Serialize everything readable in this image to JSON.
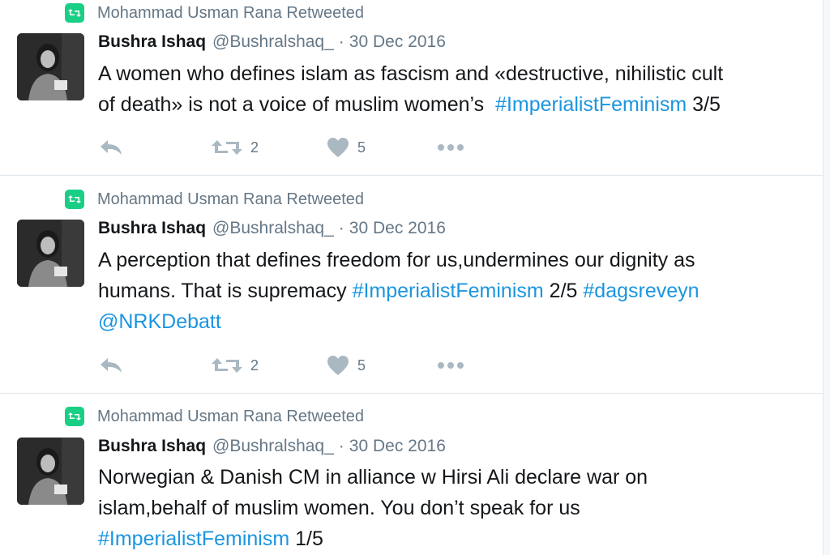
{
  "tweets": [
    {
      "retweeted_by": "Mohammad Usman Rana Retweeted",
      "name": "Bushra Ishaq",
      "handle": "@Bushralshaq_",
      "date": "30 Dec 2016",
      "lines": [
        [
          {
            "t": "A women who defines islam as fascism and «destructive, nihilistic cult"
          }
        ],
        [
          {
            "t": "of death» is not a voice of muslim women’s  "
          },
          {
            "t": "#ImperialistFeminism",
            "tag": true
          },
          {
            "t": " 3/5"
          }
        ]
      ],
      "retweets": "2",
      "likes": "5"
    },
    {
      "retweeted_by": "Mohammad Usman Rana Retweeted",
      "name": "Bushra Ishaq",
      "handle": "@Bushralshaq_",
      "date": "30 Dec 2016",
      "lines": [
        [
          {
            "t": "A perception that defines freedom for us,undermines our dignity as"
          }
        ],
        [
          {
            "t": "humans. That is supremacy "
          },
          {
            "t": "#ImperialistFeminism",
            "tag": true
          },
          {
            "t": " 2/5 "
          },
          {
            "t": "#dagsreveyn",
            "tag": true
          }
        ],
        [
          {
            "t": "@NRKDebatt",
            "tag": true
          }
        ]
      ],
      "retweets": "2",
      "likes": "5"
    },
    {
      "retweeted_by": "Mohammad Usman Rana Retweeted",
      "name": "Bushra Ishaq",
      "handle": "@Bushralshaq_",
      "date": "30 Dec 2016",
      "lines": [
        [
          {
            "t": "Norwegian & Danish CM in alliance w Hirsi Ali declare war on"
          }
        ],
        [
          {
            "t": "islam,behalf of muslim women. You don’t speak for us"
          }
        ],
        [
          {
            "t": "#ImperialistFeminism",
            "tag": true
          },
          {
            "t": " 1/5"
          }
        ]
      ],
      "retweets": "",
      "likes": ""
    }
  ],
  "icons": {
    "retweet_badge": "retweet-icon",
    "reply": "reply-icon",
    "retweet": "retweet-icon",
    "like": "heart-icon",
    "more": "more-icon"
  },
  "colors": {
    "retweet_green": "#19cf86",
    "link_blue": "#1b95e0",
    "secondary_text": "#657786",
    "action_icon": "#aab8c2"
  }
}
